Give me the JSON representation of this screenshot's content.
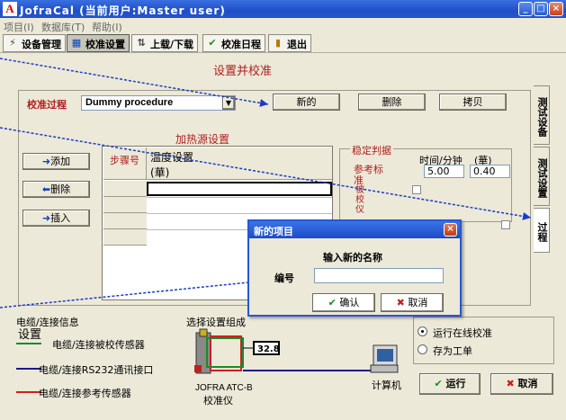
{
  "window": {
    "title": "JofraCal (当前用户:Master user)",
    "app_letter": "A"
  },
  "menu": [
    "项目(I)",
    "数据库(T)",
    "帮助(I)"
  ],
  "toolbar": [
    "设备管理",
    "校准设置",
    "上载/下载",
    "校准日程",
    "退出"
  ],
  "page_title": "设置并校准",
  "process": {
    "label": "校准过程",
    "value": "Dummy procedure",
    "buttons": [
      "新的",
      "删除",
      "拷贝"
    ]
  },
  "heat_source": {
    "title": "加热源设置",
    "col_step": "步骤号",
    "col_temp": "温度设置",
    "col_temp_unit": "(華)"
  },
  "row_buttons": [
    "添加",
    "删除",
    "插入"
  ],
  "stability": {
    "title": "稳定判据",
    "col1": "时间/分钟",
    "col2": "(華)",
    "ref_label": "参考标准",
    "ref_time": "5.00",
    "ref_temp": "0.40",
    "dut_label": "被校仪"
  },
  "side_tabs": [
    "测试设备",
    "测试设置",
    "过程"
  ],
  "cable_info": {
    "title": "电缆/连接信息",
    "subtitle": "设置",
    "items": [
      {
        "label": "电缆/连接被校传感器",
        "color": "#1a8a2a"
      },
      {
        "label": "电缆/连接RS232通讯接口",
        "color": "#1a1a8a"
      },
      {
        "label": "电缆/连接参考传感器",
        "color": "#cc2020"
      }
    ]
  },
  "setup": {
    "title": "选择设置组成",
    "instrument_line1": "JOFRA ATC-B",
    "instrument_line2": "校准仪",
    "display_value": "32.8",
    "computer_label": "计算机"
  },
  "mode": {
    "options": [
      "运行在线校准",
      "存为工单"
    ],
    "selected": 0
  },
  "actions": {
    "run": "运行",
    "cancel": "取消"
  },
  "dialog": {
    "title": "新的项目",
    "prompt": "输入新的名称",
    "field_label": "编号",
    "field_value": "",
    "ok": "确认",
    "cancel": "取消"
  }
}
